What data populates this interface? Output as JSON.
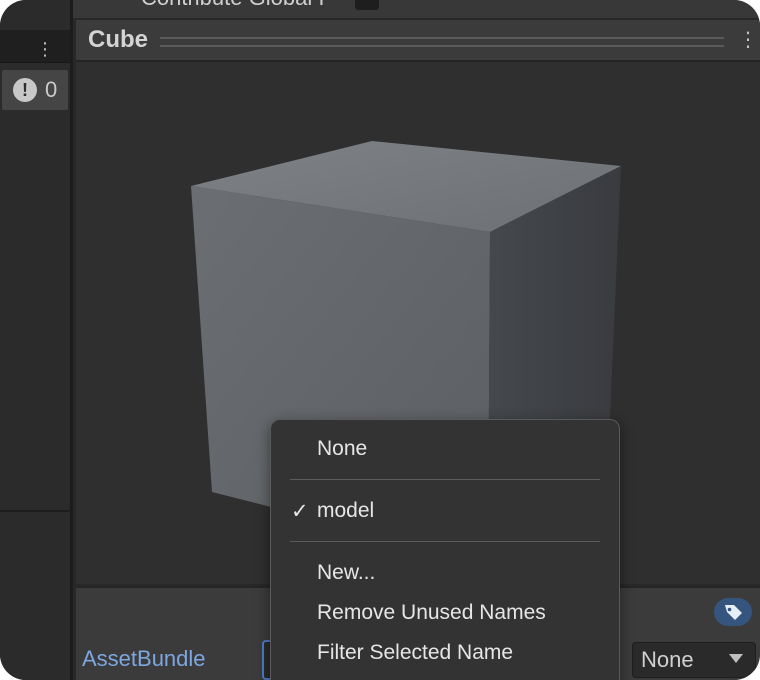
{
  "top_strip": {
    "truncated_text": "Contribute Global I"
  },
  "left_panel": {
    "issue_count": "0",
    "issue_icon": "warning-icon",
    "menu_icon": "kebab-menu-icon"
  },
  "preview": {
    "title": "Cube",
    "menu_icon": "kebab-menu-icon",
    "object": "cube"
  },
  "bottom": {
    "assetbundle_label": "AssetBundle",
    "variant_value": "None",
    "tag_icon": "tag-icon"
  },
  "context_menu": {
    "items": [
      {
        "label": "None",
        "checked": false
      },
      {
        "label": "model",
        "checked": true
      },
      {
        "label": "New...",
        "checked": false
      },
      {
        "label": "Remove Unused Names",
        "checked": false
      },
      {
        "label": "Filter Selected Name",
        "checked": false
      }
    ],
    "check_glyph": "✓"
  },
  "colors": {
    "panel_bg": "#282828",
    "link_blue": "#7ea6e0",
    "focus_blue": "#4d7bc4",
    "tag_badge": "#35547e"
  }
}
